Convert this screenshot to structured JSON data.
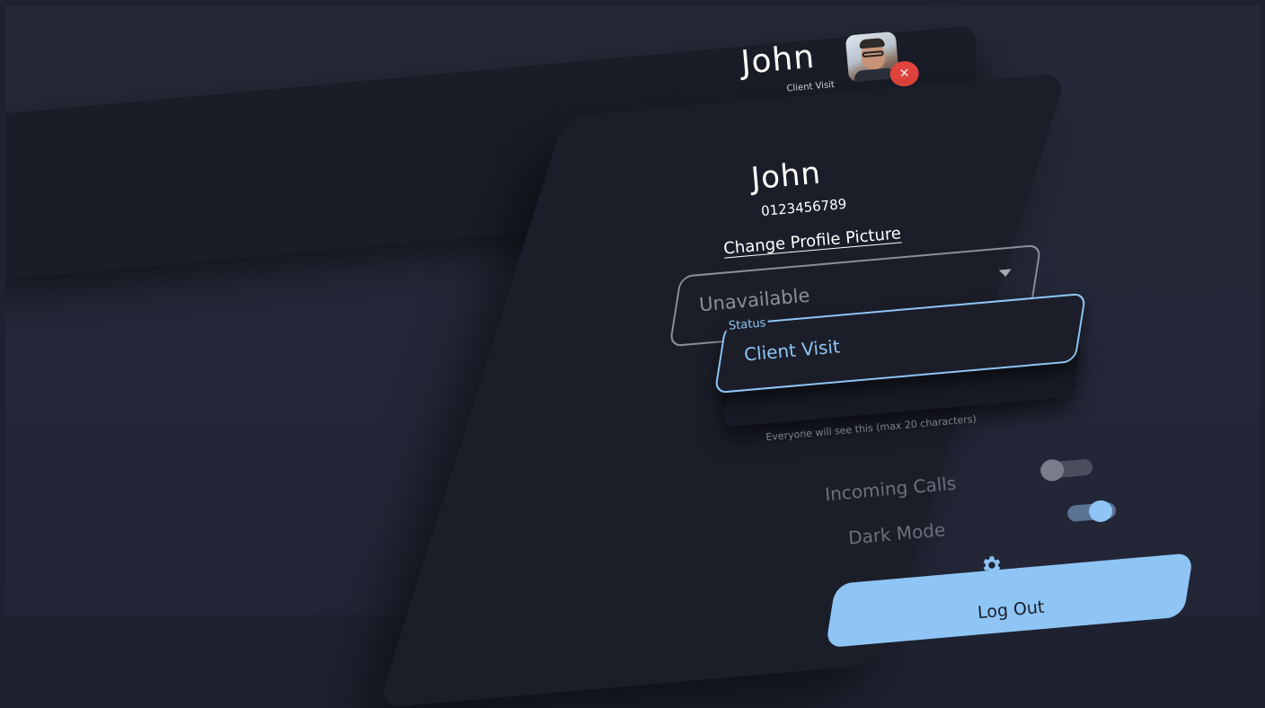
{
  "header": {
    "user_name": "John",
    "user_status": "Client Visit"
  },
  "profile": {
    "name": "John",
    "phone": "0123456789",
    "change_picture_link": "Change Profile Picture",
    "availability": {
      "selected": "Unavailable"
    },
    "status": {
      "label": "Status",
      "value": "Client Visit",
      "helper": "Everyone will see this (max 20 characters)"
    },
    "settings": {
      "incoming_calls_label": "Incoming Calls",
      "incoming_calls_on": false,
      "dark_mode_label": "Dark Mode",
      "dark_mode_on": true
    },
    "logout_label": "Log Out"
  },
  "colors": {
    "accent": "#8ec5f5",
    "danger": "#e8463f",
    "panel": "#1b1e29",
    "background": "#232737"
  }
}
